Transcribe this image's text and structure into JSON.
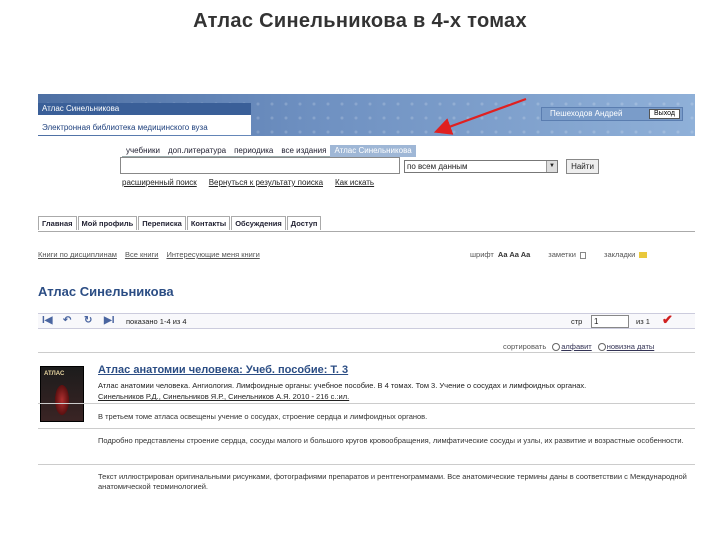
{
  "slide": {
    "title": "Атлас Синельникова в 4-х томах"
  },
  "banner": {
    "brand_title": "Атлас Синельникова",
    "brand_subtitle": "Электронная библиотека медицинского вуза",
    "user_name": "Пешеходов Андрей",
    "logout_label": "Выход"
  },
  "search": {
    "tabs": [
      "учебники",
      "доп.литература",
      "периодика",
      "все издания",
      "Атлас Синельникова"
    ],
    "active_tab": "Атлас Синельникова",
    "input_value": "",
    "scope_value": "по всем данным",
    "go_label": "Найти",
    "links": [
      "расширенный поиск",
      "Вернуться к результату поиска",
      "Как искать"
    ]
  },
  "nav": {
    "tabs": [
      "Главная",
      "Мой профиль",
      "Переписка",
      "Контакты",
      "Обсуждения",
      "Доступ"
    ]
  },
  "crumbs": [
    "Книги по дисциплинам",
    "Все книги",
    "Интересующие меня книги"
  ],
  "tools": {
    "font_label": "шрифт",
    "font_sizes": "Aa Aa Aa",
    "notes_label": "заметки",
    "bookmarks_label": "закладки"
  },
  "page": {
    "heading": "Атлас Синельникова"
  },
  "pager": {
    "shown_text": "показано 1-4 из 4",
    "page_label": "стр",
    "page_value": "1",
    "of_label": "из 1",
    "check": "✔"
  },
  "sort": {
    "label": "сортировать",
    "option_alpha": "алфавит",
    "option_new": "новизна даты"
  },
  "book": {
    "cover_text": "АТЛАС",
    "title": "Атлас анатомии человека: Учеб. пособие: Т. 3",
    "description": "Атлас анатомии человека. Ангиология. Лимфоидные органы: учебное пособие. В 4 томах. Том 3. Учение о сосудах и лимфоидных органах.",
    "authors": "Синельников Р.Д., Синельников Я.Р., Синельников А.Я. 2010 - 216 с.:ил.",
    "p1": "В третьем томе атласа освещены учение о сосудах, строение сердца и лимфоидных органов.",
    "p2": "Подробно представлены строение сердца, сосуды малого и большого кругов кровообращения, лимфатические сосуды и узлы, их развитие и возрастные особенности.",
    "p3": "Текст иллюстрирован оригинальными рисунками, фотографиями препаратов и рентгенограммами. Все анатомические термины даны в соответствии с Международной анатомической терминологией."
  },
  "colors": {
    "banner_blue": "#4d6fa3",
    "link_blue": "#2b4d84",
    "arrow_red": "#e02020"
  }
}
